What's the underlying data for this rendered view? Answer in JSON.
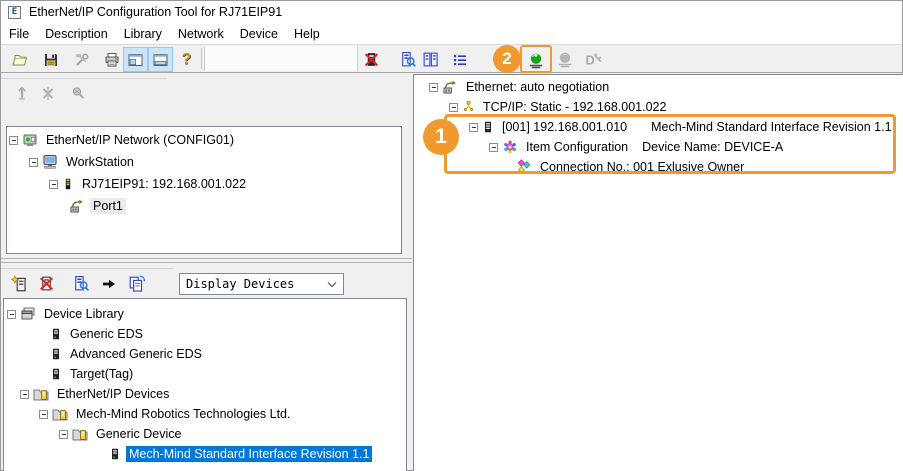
{
  "window": {
    "title": "EtherNet/IP Configuration Tool for RJ71EIP91",
    "app_icon": "ethernet-ip-tool-icon",
    "app_icon_letter": "E"
  },
  "menu": {
    "items": [
      "File",
      "Description",
      "Library",
      "Network",
      "Device",
      "Help"
    ]
  },
  "toolbar": {
    "main_icons": [
      "open-folder-icon",
      "save-icon",
      "tools-icon",
      "print-icon",
      "view-layout-left-icon",
      "view-layout-bottom-icon",
      "help-icon"
    ],
    "right_icons": [
      "delete-device-icon",
      "device-properties-icon",
      "device-compare-icon",
      "parameter-list-icon",
      "go-online-icon",
      "go-offline-icon",
      "diagnostics-icon"
    ],
    "help_glyph": "?",
    "connection_icons": [
      "upload-connection-icon",
      "delete-connection-icon",
      "verify-connection-icon"
    ]
  },
  "network_panel": {
    "rows": [
      {
        "label": "EtherNet/IP Network (CONFIG01)",
        "icon": "network-icon"
      },
      {
        "label": "WorkStation",
        "icon": "workstation-icon"
      },
      {
        "label": "RJ71EIP91: 192.168.001.022",
        "icon": "module-icon"
      },
      {
        "label": "Port1",
        "icon": "port-icon"
      }
    ]
  },
  "library_toolbar": {
    "icons": [
      "add-device-icon",
      "remove-device-icon",
      "device-properties-icon",
      "insert-device-icon",
      "duplicate-device-icon"
    ],
    "filter_value": "Display Devices"
  },
  "library_panel": {
    "rows": [
      {
        "label": "Device Library",
        "icon": "library-icon"
      },
      {
        "label": "Generic EDS",
        "icon": "eds-device-icon"
      },
      {
        "label": "Advanced Generic EDS",
        "icon": "eds-device-icon"
      },
      {
        "label": "Target(Tag)",
        "icon": "eds-device-icon"
      },
      {
        "label": "EtherNet/IP Devices",
        "icon": "device-folder-icon"
      },
      {
        "label": "Mech-Mind Robotics Technologies Ltd.",
        "icon": "device-folder-icon"
      },
      {
        "label": "Generic Device",
        "icon": "device-folder-icon"
      },
      {
        "label": "Mech-Mind Standard Interface Revision 1.1",
        "icon": "eds-device-icon",
        "selected": true
      }
    ]
  },
  "config_panel": {
    "rows": [
      {
        "label": "Ethernet: auto negotiation",
        "icon": "ethernet-port-icon"
      },
      {
        "label": "TCP/IP: Static - 192.168.001.022",
        "icon": "tcpip-icon"
      },
      {
        "address": "[001] 192.168.001.010",
        "device": "Mech-Mind Standard Interface Revision 1.1",
        "icon": "device-module-icon"
      },
      {
        "label": "Item Configuration",
        "detail": "Device Name: DEVICE-A",
        "icon": "item-config-gear-icon"
      },
      {
        "label": "Connection No.: 001 Exlusive Owner",
        "icon": "connection-diamonds-icon"
      }
    ]
  },
  "annotations": {
    "step1": "1",
    "step2": "2",
    "accent_color": "#F0992E"
  },
  "colors": {
    "selection_blue": "#0078D7",
    "toolbar_toggle_bg": "#CCE4F7"
  }
}
